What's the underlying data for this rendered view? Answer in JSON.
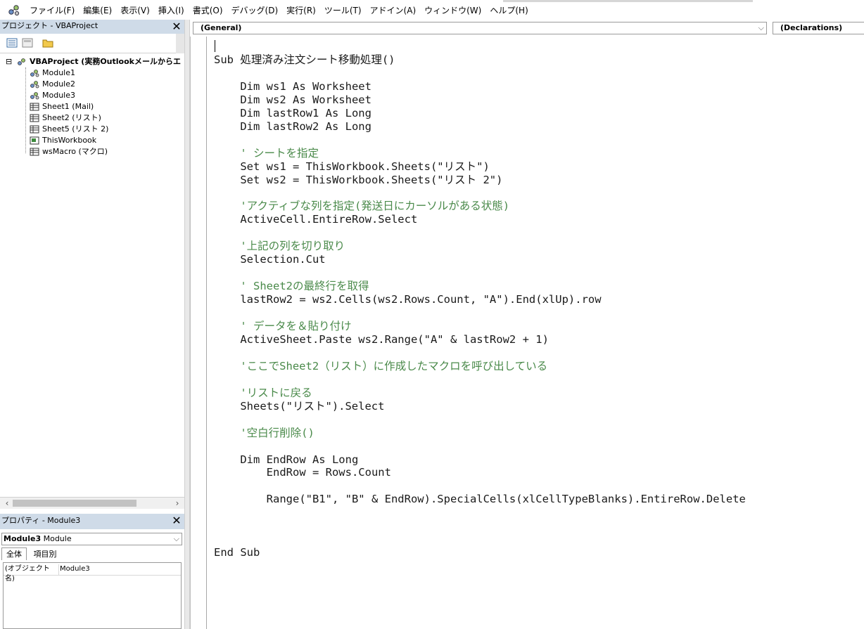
{
  "menu": {
    "items": [
      "ファイル(F)",
      "編集(E)",
      "表示(V)",
      "挿入(I)",
      "書式(O)",
      "デバッグ(D)",
      "実行(R)",
      "ツール(T)",
      "アドイン(A)",
      "ウィンドウ(W)",
      "ヘルプ(H)"
    ]
  },
  "project": {
    "title": "プロジェクト - VBAProject",
    "close": "✕",
    "root": "VBAProject (実務Outlookメールからエ",
    "items": [
      {
        "label": "Module1",
        "icon": "module-icon"
      },
      {
        "label": "Module2",
        "icon": "module-icon"
      },
      {
        "label": "Module3",
        "icon": "module-icon"
      },
      {
        "label": "Sheet1 (Mail)",
        "icon": "sheet-icon"
      },
      {
        "label": "Sheet2 (リスト)",
        "icon": "sheet-icon"
      },
      {
        "label": "Sheet5 (リスト 2)",
        "icon": "sheet-icon"
      },
      {
        "label": "ThisWorkbook",
        "icon": "workbook-icon"
      },
      {
        "label": "wsMacro (マクロ)",
        "icon": "sheet-icon"
      }
    ]
  },
  "properties": {
    "title": "プロパティ - Module3",
    "close": "✕",
    "object_name": "Module3",
    "object_type": "Module",
    "tabs": [
      "全体",
      "項目別"
    ],
    "rows": [
      {
        "key": "(オブジェクト名)",
        "value": "Module3"
      }
    ]
  },
  "code": {
    "object_combo": "(General)",
    "proc_combo": "(Declarations)",
    "lines": [
      {
        "text": "Sub 処理済み注文シート移動処理()",
        "comment": false
      },
      {
        "text": "",
        "comment": false
      },
      {
        "text": "    Dim ws1 As Worksheet",
        "comment": false
      },
      {
        "text": "    Dim ws2 As Worksheet",
        "comment": false
      },
      {
        "text": "    Dim lastRow1 As Long",
        "comment": false
      },
      {
        "text": "    Dim lastRow2 As Long",
        "comment": false
      },
      {
        "text": "",
        "comment": false
      },
      {
        "text": "    ' シートを指定",
        "comment": true
      },
      {
        "text": "    Set ws1 = ThisWorkbook.Sheets(\"リスト\")",
        "comment": false
      },
      {
        "text": "    Set ws2 = ThisWorkbook.Sheets(\"リスト 2\")",
        "comment": false
      },
      {
        "text": "",
        "comment": false
      },
      {
        "text": "    'アクティブな列を指定(発送日にカーソルがある状態)",
        "comment": true
      },
      {
        "text": "    ActiveCell.EntireRow.Select",
        "comment": false
      },
      {
        "text": "",
        "comment": false
      },
      {
        "text": "    '上記の列を切り取り",
        "comment": true
      },
      {
        "text": "    Selection.Cut",
        "comment": false
      },
      {
        "text": "",
        "comment": false
      },
      {
        "text": "    ' Sheet2の最終行を取得",
        "comment": true
      },
      {
        "text": "    lastRow2 = ws2.Cells(ws2.Rows.Count, \"A\").End(xlUp).row",
        "comment": false
      },
      {
        "text": "",
        "comment": false
      },
      {
        "text": "    ' データを＆貼り付け",
        "comment": true
      },
      {
        "text": "    ActiveSheet.Paste ws2.Range(\"A\" & lastRow2 + 1)",
        "comment": false
      },
      {
        "text": "",
        "comment": false
      },
      {
        "text": "    'ここでSheet2（リスト）に作成したマクロを呼び出している",
        "comment": true
      },
      {
        "text": "",
        "comment": false
      },
      {
        "text": "    'リストに戻る",
        "comment": true
      },
      {
        "text": "    Sheets(\"リスト\").Select",
        "comment": false
      },
      {
        "text": "",
        "comment": false
      },
      {
        "text": "    '空白行削除()",
        "comment": true
      },
      {
        "text": "",
        "comment": false
      },
      {
        "text": "    Dim EndRow As Long",
        "comment": false
      },
      {
        "text": "        EndRow = Rows.Count",
        "comment": false
      },
      {
        "text": "",
        "comment": false
      },
      {
        "text": "        Range(\"B1\", \"B\" & EndRow).SpecialCells(xlCellTypeBlanks).EntireRow.Delete",
        "comment": false
      },
      {
        "text": "",
        "comment": false
      },
      {
        "text": "",
        "comment": false
      },
      {
        "text": "",
        "comment": false
      },
      {
        "text": "End Sub",
        "comment": false
      }
    ]
  },
  "colors": {
    "comment": "#4a8a4a",
    "title_bar": "#cfdbe8"
  }
}
